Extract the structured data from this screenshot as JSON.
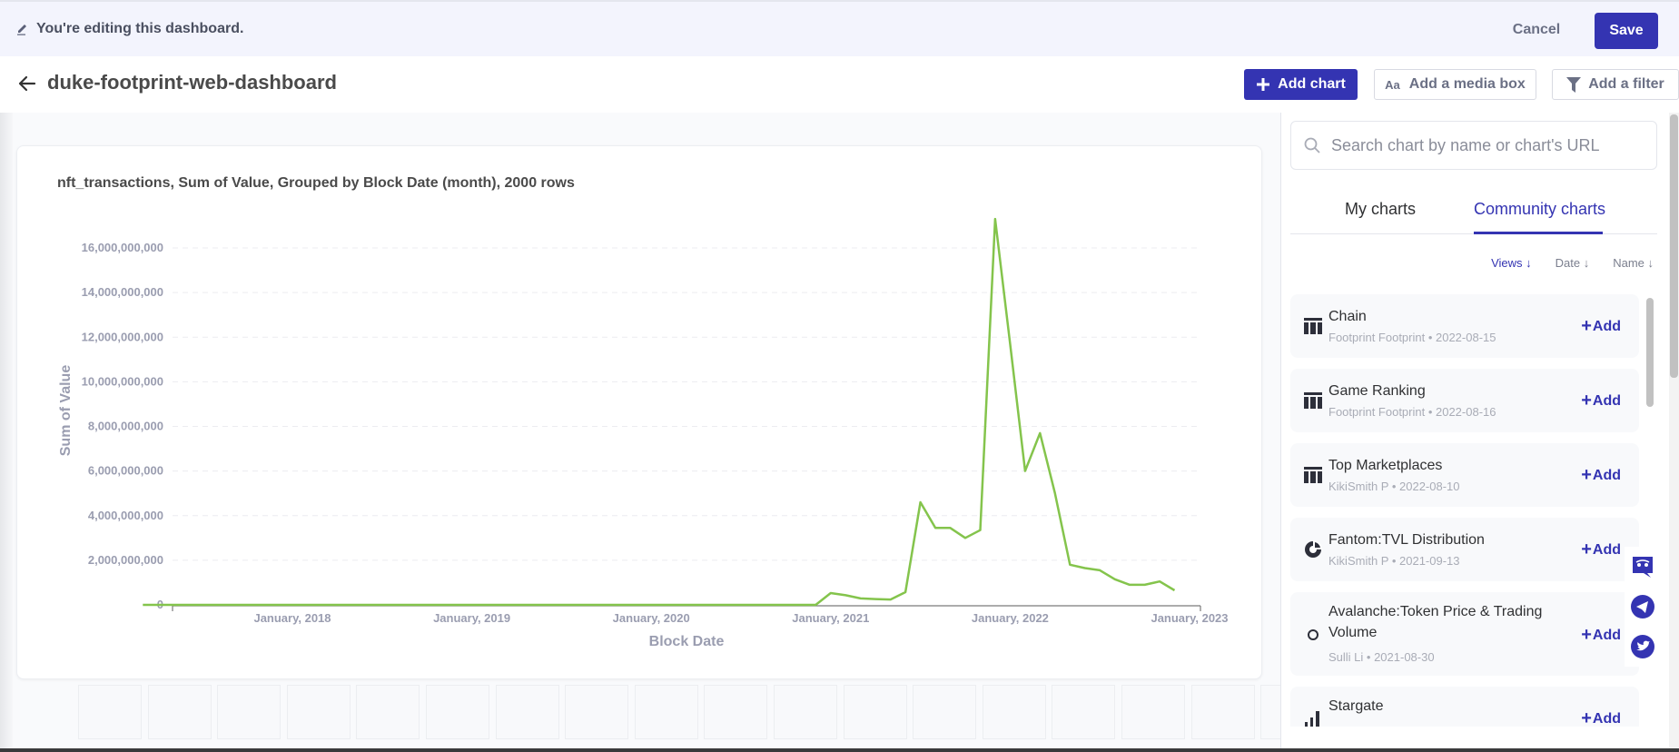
{
  "edit_bar": {
    "message": "You're editing this dashboard.",
    "cancel_label": "Cancel",
    "save_label": "Save"
  },
  "header": {
    "title": "duke-footprint-web-dashboard",
    "add_chart_label": "Add chart",
    "media_box_icon_text": "Aa",
    "media_box_label": "Add a media box",
    "filter_label": "Add a filter"
  },
  "colors": {
    "accent": "#3434b2",
    "line": "#84c44c",
    "axis_text": "#9a9db0"
  },
  "card": {
    "title": "nft_transactions, Sum of Value, Grouped by Block Date (month), 2000 rows"
  },
  "chart_data": {
    "type": "line",
    "title": "nft_transactions, Sum of Value, Grouped by Block Date (month), 2000 rows",
    "xlabel": "Block Date",
    "ylabel": "Sum of Value",
    "ylim": [
      0,
      16000000000
    ],
    "yticks": [
      0,
      2000000000,
      4000000000,
      6000000000,
      8000000000,
      10000000000,
      12000000000,
      14000000000,
      16000000000
    ],
    "ytick_labels": [
      "0",
      "2,000,000,000",
      "4,000,000,000",
      "6,000,000,000",
      "8,000,000,000",
      "10,000,000,000",
      "12,000,000,000",
      "14,000,000,000",
      "16,000,000,000"
    ],
    "xlim": [
      "2017-02",
      "2023-04"
    ],
    "xticks": [
      "2018-01",
      "2019-01",
      "2020-01",
      "2021-01",
      "2022-01",
      "2023-01"
    ],
    "xtick_labels": [
      "January, 2018",
      "January, 2019",
      "January, 2020",
      "January, 2021",
      "January, 2022",
      "January, 2023"
    ],
    "grid": true,
    "legend": "none",
    "series": [
      {
        "name": "Sum of Value",
        "x": [
          "2017-03",
          "2020-12",
          "2021-01",
          "2021-02",
          "2021-03",
          "2021-04",
          "2021-05",
          "2021-06",
          "2021-07",
          "2021-08",
          "2021-09",
          "2021-10",
          "2021-11",
          "2021-12",
          "2022-01",
          "2022-02",
          "2022-03",
          "2022-04",
          "2022-05",
          "2022-06",
          "2022-07",
          "2022-08",
          "2022-09",
          "2022-10",
          "2022-11",
          "2022-12",
          "2023-01"
        ],
        "values": [
          0,
          0,
          530000000,
          430000000,
          290000000,
          260000000,
          240000000,
          570000000,
          4600000000,
          3450000000,
          3450000000,
          3000000000,
          3350000000,
          17300000000,
          11700000000,
          6000000000,
          7700000000,
          5000000000,
          1800000000,
          1650000000,
          1550000000,
          1150000000,
          900000000,
          900000000,
          1050000000,
          650000000,
          0
        ]
      }
    ]
  },
  "panel": {
    "search_placeholder": "Search chart by name or chart's URL",
    "tabs": [
      {
        "label": "My charts",
        "active": false
      },
      {
        "label": "Community charts",
        "active": true
      }
    ],
    "sorts": [
      {
        "label": "Views ↓",
        "active": true
      },
      {
        "label": "Date ↓",
        "active": false
      },
      {
        "label": "Name ↓",
        "active": false
      }
    ],
    "add_label": "Add",
    "items": [
      {
        "name": "Chain",
        "meta": "Footprint Footprint • 2022-08-15",
        "icon": "table-icon"
      },
      {
        "name": "Game Ranking",
        "meta": "Footprint Footprint • 2022-08-16",
        "icon": "table-icon"
      },
      {
        "name": "Top Marketplaces",
        "meta": "KikiSmith P • 2022-08-10",
        "icon": "table-icon"
      },
      {
        "name": "Fantom:TVL Distribution",
        "meta": "KikiSmith P • 2021-09-13",
        "icon": "pie-chart-icon"
      },
      {
        "name": "Avalanche:Token Price & Trading Volume",
        "meta": "Sulli Li • 2021-08-30",
        "icon": "circle-icon"
      },
      {
        "name": "Stargate",
        "meta": "",
        "icon": "bar-chart-icon"
      }
    ]
  },
  "social": [
    "discord-icon",
    "telegram-icon",
    "twitter-icon"
  ]
}
